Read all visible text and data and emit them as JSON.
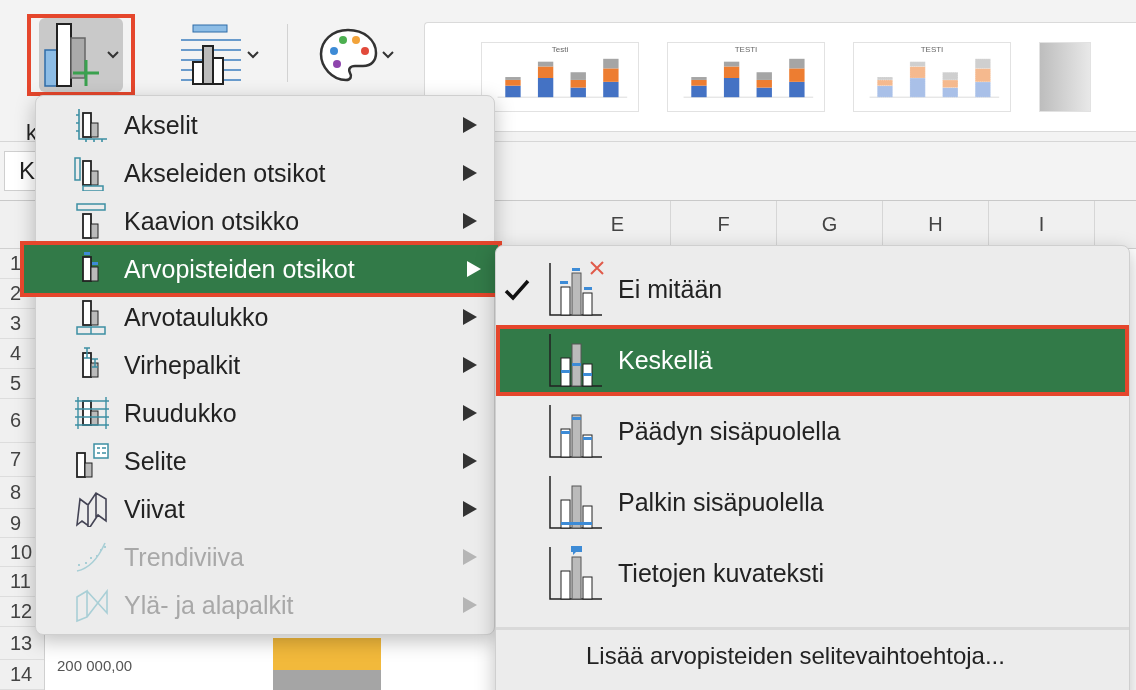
{
  "ribbon": {
    "buttons": [
      {
        "kind": "add-element",
        "selected": true
      },
      {
        "kind": "layout",
        "selected": false
      },
      {
        "kind": "colors",
        "selected": false
      }
    ],
    "styles": [
      {
        "kind": "legend-bottom",
        "title": "Testi"
      },
      {
        "kind": "labels",
        "title": "TESTI"
      },
      {
        "kind": "striped",
        "title": "TESTI"
      },
      {
        "kind": "cut"
      }
    ]
  },
  "ribbon_fragment": "k",
  "name_box": "K",
  "sheet": {
    "columns": [
      "E",
      "F",
      "G",
      "H",
      "I"
    ],
    "rows": [
      "1",
      "2",
      "3",
      "4",
      "5",
      "6",
      "7",
      "8",
      "9",
      "10",
      "11",
      "12",
      "13",
      "14"
    ],
    "chart": {
      "axis_label": "200 000,00"
    }
  },
  "menu": {
    "items": [
      {
        "label": "Akselit",
        "kind": "axes",
        "selected": false,
        "disabled": false
      },
      {
        "label": "Akseleiden otsikot",
        "kind": "axis-titles",
        "selected": false,
        "disabled": false
      },
      {
        "label": "Kaavion otsikko",
        "kind": "chart-title",
        "selected": false,
        "disabled": false
      },
      {
        "label": "Arvopisteiden otsikot",
        "kind": "data-labels",
        "selected": true,
        "disabled": false
      },
      {
        "label": "Arvotaulukko",
        "kind": "data-table",
        "selected": false,
        "disabled": false
      },
      {
        "label": "Virhepalkit",
        "kind": "error-bars",
        "selected": false,
        "disabled": false
      },
      {
        "label": "Ruudukko",
        "kind": "gridlines",
        "selected": false,
        "disabled": false
      },
      {
        "label": "Selite",
        "kind": "legend",
        "selected": false,
        "disabled": false
      },
      {
        "label": "Viivat",
        "kind": "lines",
        "selected": false,
        "disabled": false
      },
      {
        "label": "Trendiviiva",
        "kind": "trendline",
        "selected": false,
        "disabled": true
      },
      {
        "label": "Ylä- ja alapalkit",
        "kind": "updown",
        "selected": false,
        "disabled": true
      }
    ]
  },
  "submenu": {
    "items": [
      {
        "label": "Ei mitään",
        "kind": "none",
        "checked": true,
        "selected": false
      },
      {
        "label": "Keskellä",
        "kind": "center",
        "checked": false,
        "selected": true
      },
      {
        "label": "Päädyn sisäpuolella",
        "kind": "inside-end",
        "checked": false,
        "selected": false
      },
      {
        "label": "Palkin sisäpuolella",
        "kind": "inside-base",
        "checked": false,
        "selected": false
      },
      {
        "label": "Tietojen kuvateksti",
        "kind": "callout",
        "checked": false,
        "selected": false
      }
    ],
    "more": "Lisää arvopisteiden selitevaihtoehtoja..."
  }
}
